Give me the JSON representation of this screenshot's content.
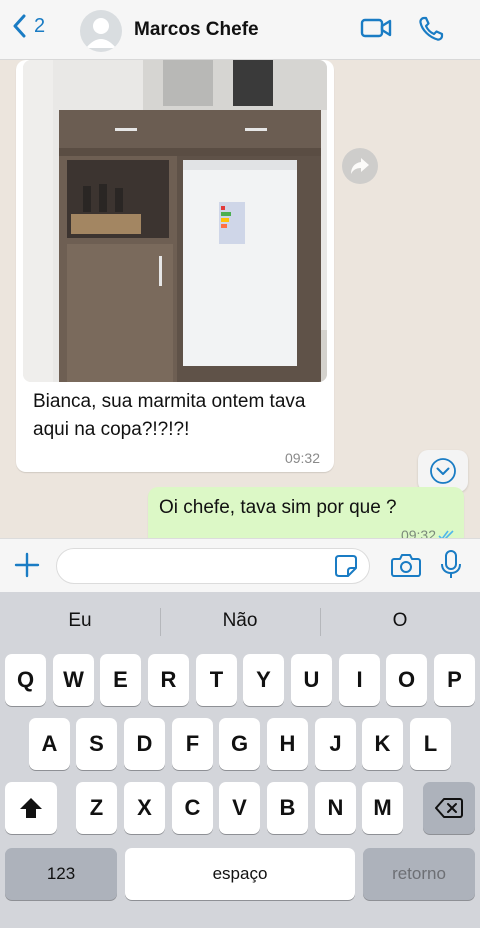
{
  "header": {
    "back_count": "2",
    "contact_name": "Marcos Chefe"
  },
  "messages": {
    "incoming": {
      "text": "Bianca, sua marmita ontem tava aqui na copa?!?!?!",
      "time": "09:32"
    },
    "outgoing": {
      "text": "Oi chefe, tava sim por que ?",
      "time": "09:32"
    }
  },
  "composer": {
    "value": "",
    "placeholder": ""
  },
  "keyboard": {
    "suggestions": [
      "Eu",
      "Não",
      "O"
    ],
    "row1": [
      "Q",
      "W",
      "E",
      "R",
      "T",
      "Y",
      "U",
      "I",
      "O",
      "P"
    ],
    "row2": [
      "A",
      "S",
      "D",
      "F",
      "G",
      "H",
      "J",
      "K",
      "L"
    ],
    "row3": [
      "Z",
      "X",
      "C",
      "V",
      "B",
      "N",
      "M"
    ],
    "numbers_label": "123",
    "space_label": "espaço",
    "return_label": "retorno"
  },
  "colors": {
    "accent": "#1a7cc4",
    "incoming_bubble": "#ffffff",
    "outgoing_bubble": "#dcf8c6",
    "chat_background": "#ece5dd",
    "keyboard_background": "#d3d5da"
  },
  "icons": {
    "back": "chevron-left-icon",
    "video": "video-camera-icon",
    "call": "phone-icon",
    "forward": "forward-arrow-icon",
    "scroll": "chevron-down-icon",
    "attach": "plus-icon",
    "sticker": "sticker-icon",
    "camera": "camera-icon",
    "mic": "microphone-icon",
    "shift": "shift-arrow-icon",
    "backspace": "backspace-icon"
  }
}
